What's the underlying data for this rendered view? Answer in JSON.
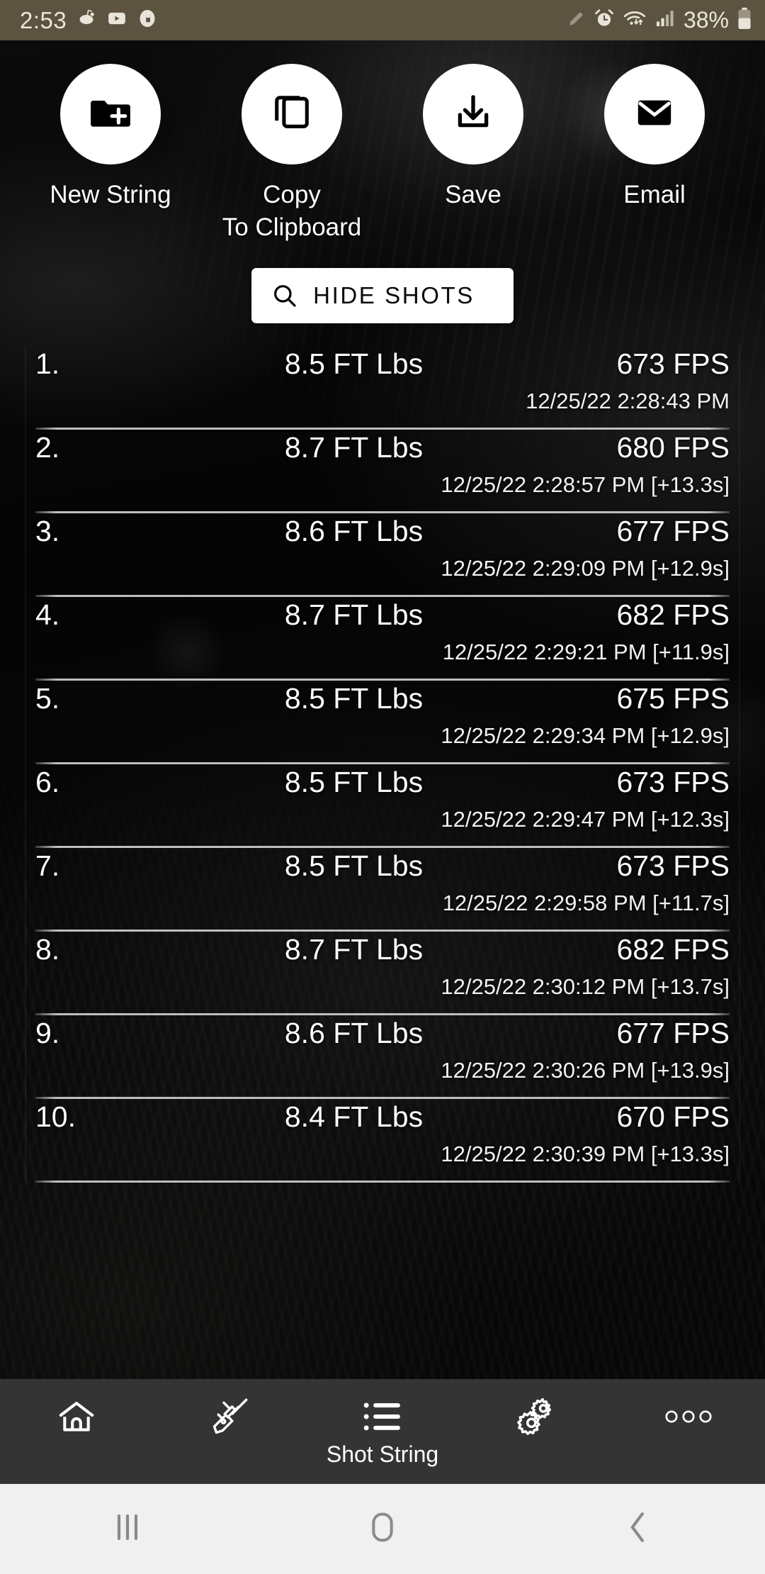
{
  "statusbar": {
    "time": "2:53",
    "battery_percent": "38%",
    "left_icons": [
      "reddit-icon",
      "youtube-icon",
      "pocketcasts-icon"
    ],
    "right_icons": [
      "pencil-icon",
      "alarm-icon",
      "wifi-icon",
      "signal-icon",
      "battery-icon"
    ],
    "background_color": "#5c5340"
  },
  "actions": [
    {
      "label": "New String",
      "icon": "new-folder-icon"
    },
    {
      "label": "Copy\nTo Clipboard",
      "label_line1": "Copy",
      "label_line2": "To Clipboard",
      "icon": "copy-icon"
    },
    {
      "label": "Save",
      "icon": "download-icon"
    },
    {
      "label": "Email",
      "icon": "envelope-icon"
    }
  ],
  "hide_shots_button": {
    "label": "HIDE SHOTS",
    "icon": "search-icon"
  },
  "shots": {
    "energy_unit": "FT Lbs",
    "speed_unit": "FPS",
    "rows": [
      {
        "index": "1.",
        "energy": "8.5 FT Lbs",
        "speed": "673 FPS",
        "timestamp": "12/25/22 2:28:43 PM"
      },
      {
        "index": "2.",
        "energy": "8.7 FT Lbs",
        "speed": "680 FPS",
        "timestamp": "12/25/22 2:28:57 PM [+13.3s]"
      },
      {
        "index": "3.",
        "energy": "8.6 FT Lbs",
        "speed": "677 FPS",
        "timestamp": "12/25/22 2:29:09 PM [+12.9s]"
      },
      {
        "index": "4.",
        "energy": "8.7 FT Lbs",
        "speed": "682 FPS",
        "timestamp": "12/25/22 2:29:21 PM [+11.9s]"
      },
      {
        "index": "5.",
        "energy": "8.5 FT Lbs",
        "speed": "675 FPS",
        "timestamp": "12/25/22 2:29:34 PM [+12.9s]"
      },
      {
        "index": "6.",
        "energy": "8.5 FT Lbs",
        "speed": "673 FPS",
        "timestamp": "12/25/22 2:29:47 PM [+12.3s]"
      },
      {
        "index": "7.",
        "energy": "8.5 FT Lbs",
        "speed": "673 FPS",
        "timestamp": "12/25/22 2:29:58 PM [+11.7s]"
      },
      {
        "index": "8.",
        "energy": "8.7 FT Lbs",
        "speed": "682 FPS",
        "timestamp": "12/25/22 2:30:12 PM [+13.7s]"
      },
      {
        "index": "9.",
        "energy": "8.6 FT Lbs",
        "speed": "677 FPS",
        "timestamp": "12/25/22 2:30:26 PM [+13.9s]"
      },
      {
        "index": "10.",
        "energy": "8.4 FT Lbs",
        "speed": "670 FPS",
        "timestamp": "12/25/22 2:30:39 PM [+13.3s]"
      }
    ]
  },
  "app_nav": [
    {
      "label": "",
      "icon": "home-icon",
      "active": false
    },
    {
      "label": "",
      "icon": "rifle-icon",
      "active": false
    },
    {
      "label": "Shot String",
      "icon": "list-icon",
      "active": true
    },
    {
      "label": "",
      "icon": "gears-icon",
      "active": false
    },
    {
      "label": "",
      "icon": "more-icon",
      "active": false
    }
  ],
  "system_nav": [
    {
      "icon": "recents-icon"
    },
    {
      "icon": "home-square-icon"
    },
    {
      "icon": "back-icon"
    }
  ],
  "colors": {
    "status_bar": "#5c5340",
    "app_nav_bar": "#343434",
    "system_nav_bar": "#f0f0f0",
    "accent_button": "#ffffff",
    "text": "#ffffff"
  }
}
